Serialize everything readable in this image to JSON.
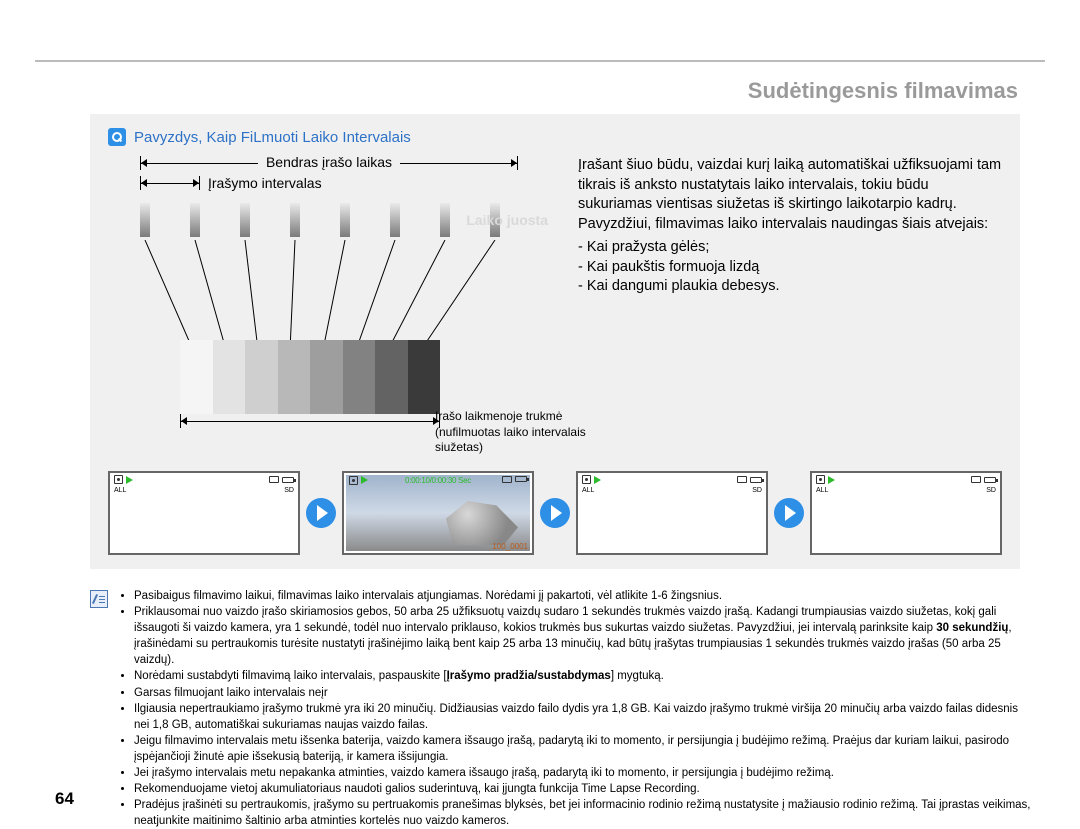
{
  "page": {
    "number": "64",
    "section_title": "Sudėtingesnis filmavimas"
  },
  "panel": {
    "subtitle": "Pavyzdys, Kaip FiLmuoti Laiko Intervalais",
    "bracket_top": "Bendras įrašo laikas",
    "bracket_mid": "Įrašymo intervalas",
    "timeline_label": "Laiko juosta",
    "grad_label": "Įrašo laikmenoje trukmė\n(nufilmuotas laiko intervalais siužetas)",
    "description": "Įrašant šiuo būdu, vaizdai kurį laiką automatiškai užfiksuojami tam tikrais iš anksto nustatytais laiko intervalais, tokiu būdu sukuriamas vientisas siužetas iš skirtingo laikotarpio kadrų. Pavyzdžiui, filmavimas laiko intervalais naudingas šiais atvejais:",
    "cases": [
      "Kai pražysta gėlės;",
      "Kai paukštis formuoja lizdą",
      "Kai dangumi plaukia debesys."
    ],
    "thumb": {
      "timecode": "0:00:10/0:00:30 Sec",
      "clip": "100_0001",
      "all": "ALL",
      "sd": "SD"
    }
  },
  "notes": {
    "items": [
      "Pasibaigus filmavimo laikui, filmavimas laiko intervalais atjungiamas. Norėdami jį pakartoti, vėl atlikite 1-6 žingsnius.",
      "Priklausomai nuo vaizdo įrašo skiriamosios gebos, 50 arba 25 užfiksuotų vaizdų sudaro 1 sekundės trukmės vaizdo įrašą. Kadangi trumpiausias vaizdo siužetas, kokį gali išsaugoti ši vaizdo kamera, yra 1 sekundė, todėl nuo intervalo priklauso, kokios trukmės bus sukurtas vaizdo siužetas. Pavyzdžiui, jei intervalą parinksite kaip 30 sekundžių, įrašinėdami su pertraukomis turėsite nustatyti įrašinėjimo laiką bent kaip 25 arba 13 minučių, kad būtų įrašytas trumpiausias 1 sekundės trukmės vaizdo įrašas (50 arba 25 vaizdų).",
      "Norėdami sustabdyti filmavimą laiko intervalais, paspauskite [Įrašymo pradžia/sustabdymas] mygtuką.",
      "Garsas filmuojant laiko intervalais neįr",
      "Ilgiausia nepertraukiamo įrašymo trukmė yra iki 20 minučių. Didžiausias vaizdo failo dydis yra 1,8 GB. Kai vaizdo įrašymo trukmė viršija 20 minučių arba vaizdo failas didesnis nei 1,8 GB, automatiškai sukuriamas naujas vaizdo failas.",
      "Jeigu filmavimo intervalais metu išsenka baterija, vaizdo kamera išsaugo įrašą, padarytą iki to momento, ir persijungia į budėjimo režimą. Praėjus dar kuriam laikui, pasirodo įspėjančioji žinutė apie išsekusią bateriją, ir kamera išsijungia.",
      "Jei įrašymo intervalais metu nepakanka atminties, vaizdo kamera išsaugo įrašą, padarytą iki to momento, ir persijungia į budėjimo režimą.",
      "Rekomenduojame vietoj akumuliatoriaus naudoti galios suderintuvą, kai įjungta funkcija Time Lapse Recording.",
      "Pradėjus įrašinėti su pertraukomis, įrašymo su pertruakomis pranešimas blyksės, bet jei informacinio rodinio režimą nustatysite į mažiausio rodinio režimą. Tai įprastas veikimas, neatjunkite maitinimo šaltinio arba atminties kortelės nuo vaizdo kameros."
    ],
    "bold_fragment": "30 sekundžių",
    "bold_fragment2": "Įrašymo pradžia/sustabdymas"
  }
}
